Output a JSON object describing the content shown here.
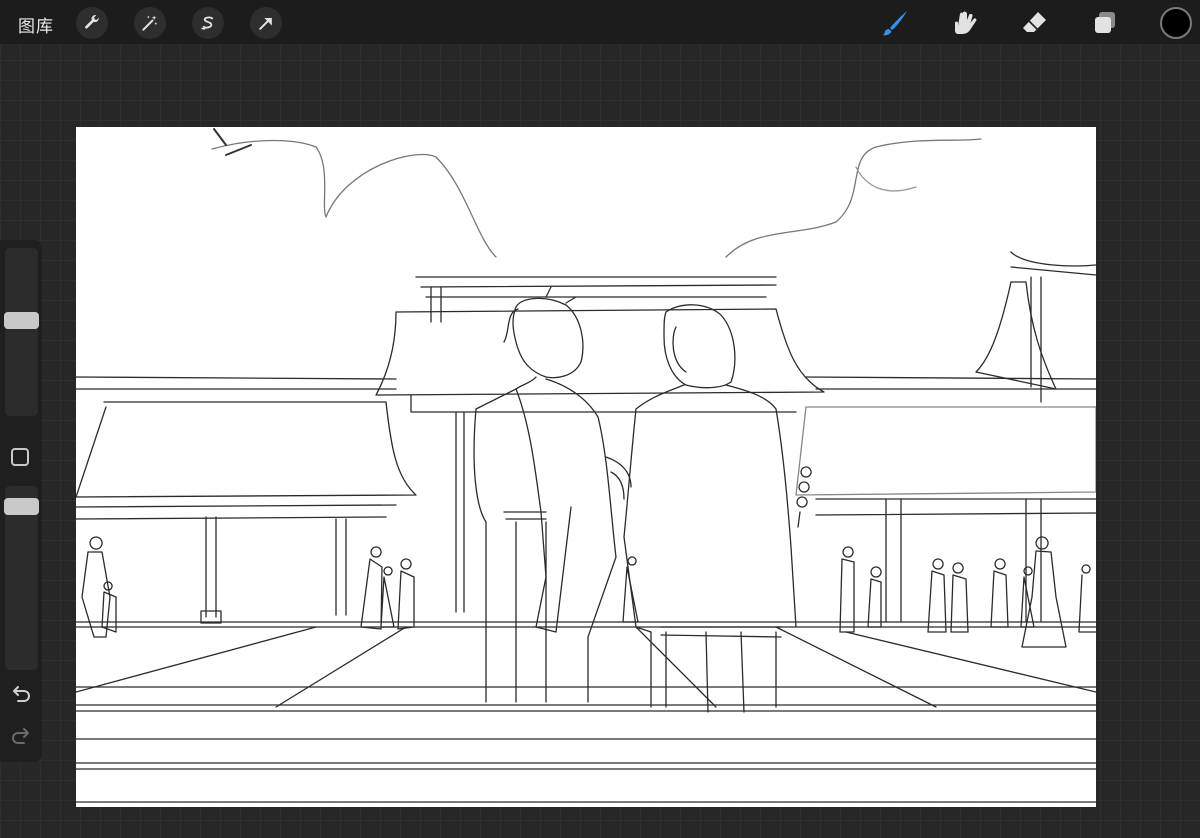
{
  "toolbar": {
    "gallery_label": "图库",
    "left_tools": [
      "wrench-icon",
      "magic-wand-icon",
      "selection-icon",
      "transform-arrow-icon"
    ],
    "right_tools": [
      "brush-icon",
      "smudge-icon",
      "eraser-icon",
      "layers-icon"
    ],
    "active_tool": "brush-icon",
    "active_color": "#3a8ff0",
    "current_color": "#000000"
  },
  "sidebar": {
    "brush_size": 0.45,
    "opacity": 0.95,
    "controls": [
      "undo-icon",
      "redo-icon"
    ]
  }
}
